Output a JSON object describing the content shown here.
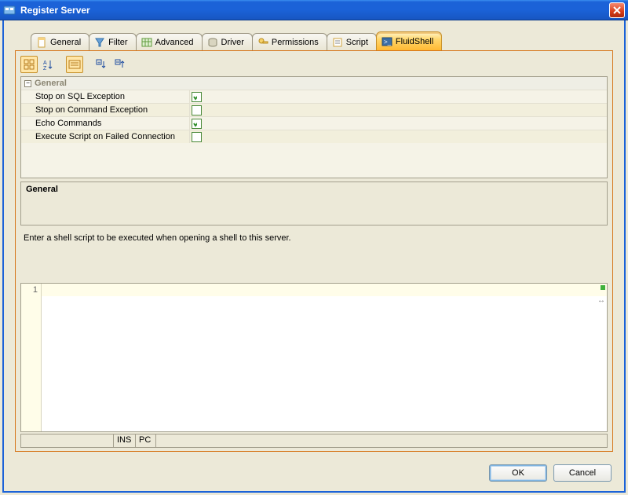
{
  "window": {
    "title": "Register Server"
  },
  "tabs": [
    {
      "label": "General"
    },
    {
      "label": "Filter"
    },
    {
      "label": "Advanced"
    },
    {
      "label": "Driver"
    },
    {
      "label": "Permissions"
    },
    {
      "label": "Script"
    },
    {
      "label": "FluidShell"
    }
  ],
  "active_tab_index": 6,
  "properties": {
    "section_title": "General",
    "rows": [
      {
        "label": "Stop on SQL Exception",
        "checked": true
      },
      {
        "label": "Stop on Command Exception",
        "checked": false
      },
      {
        "label": "Echo Commands",
        "checked": true
      },
      {
        "label": "Execute Script on Failed Connection",
        "checked": false
      }
    ]
  },
  "description_panel": {
    "title": "General"
  },
  "hint_text": "Enter a shell script to be executed when opening a shell to this server.",
  "editor": {
    "first_line_number": "1",
    "content": ""
  },
  "statusbar": {
    "mode": "INS",
    "encoding": "PC"
  },
  "buttons": {
    "ok": "OK",
    "cancel": "Cancel"
  }
}
